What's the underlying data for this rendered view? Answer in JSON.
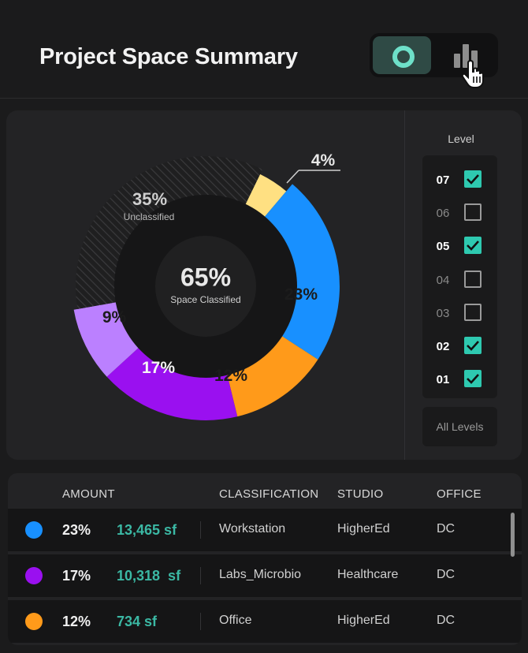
{
  "header": {
    "title": "Project Space Summary"
  },
  "view_toggle": {
    "active": "donut",
    "options": [
      "donut-chart-icon",
      "bar-chart-icon"
    ],
    "accent_color": "#6ee0c9"
  },
  "chart": {
    "center_value": "65%",
    "center_label": "Space Classified",
    "unclassified_value": "35%",
    "unclassified_label": "Unclassified",
    "segments": [
      {
        "label": "4%",
        "value": 4,
        "color": "#ffe082"
      },
      {
        "label": "23%",
        "value": 23,
        "color": "#1890ff"
      },
      {
        "label": "12%",
        "value": 12,
        "color": "#ff9a1a"
      },
      {
        "label": "17%",
        "value": 17,
        "color": "#9a10f0"
      },
      {
        "label": "9%",
        "value": 9,
        "color": "#bb80ff"
      }
    ],
    "unclassified_percent": 35
  },
  "levels": {
    "title": "Level",
    "items": [
      {
        "label": "07",
        "checked": true
      },
      {
        "label": "06",
        "checked": false
      },
      {
        "label": "05",
        "checked": true
      },
      {
        "label": "04",
        "checked": false
      },
      {
        "label": "03",
        "checked": false
      },
      {
        "label": "02",
        "checked": true
      },
      {
        "label": "01",
        "checked": true
      }
    ],
    "all_levels_label": "All Levels",
    "check_color": "#2ec9b0"
  },
  "table": {
    "columns": [
      "AMOUNT",
      "CLASSIFICATION",
      "STUDIO",
      "OFFICE"
    ],
    "rows": [
      {
        "color": "#1890ff",
        "percent": "23%",
        "area": "13,465 sf",
        "classification": "Workstation",
        "studio": "HigherEd",
        "office": "DC"
      },
      {
        "color": "#9a10f0",
        "percent": "17%",
        "area": "10,318  sf",
        "classification": "Labs_Microbio",
        "studio": "Healthcare",
        "office": "DC"
      },
      {
        "color": "#ff9a1a",
        "percent": "12%",
        "area": "734 sf",
        "classification": "Office",
        "studio": "HigherEd",
        "office": "DC"
      }
    ]
  }
}
